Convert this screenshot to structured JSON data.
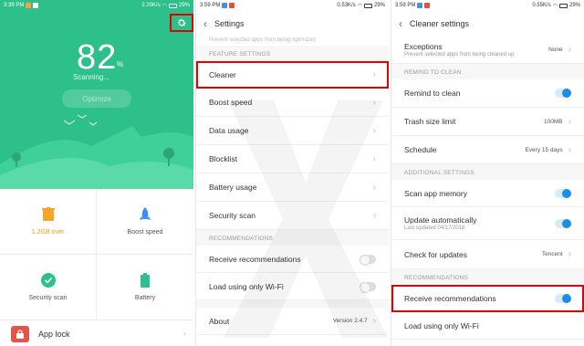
{
  "status": {
    "p1": {
      "time": "3:39 PM",
      "speed": "2.20K/s",
      "battery": "29%"
    },
    "p2": {
      "time": "3:59 PM",
      "speed": "0.53K/s",
      "battery": "29%"
    },
    "p3": {
      "time": "3:59 PM",
      "speed": "0.55K/s",
      "battery": "29%"
    }
  },
  "home": {
    "percent": "82",
    "percent_sign": "%",
    "scanning": "Scanning...",
    "optimize_label": "Optimize",
    "tiles": [
      {
        "label": "1.2GB over",
        "icon": "trash-icon"
      },
      {
        "label": "Boost speed",
        "icon": "rocket-icon"
      },
      {
        "label": "Security scan",
        "icon": "shield-check-icon"
      },
      {
        "label": "Battery",
        "icon": "battery-icon"
      }
    ],
    "app_lock": "App lock"
  },
  "settings": {
    "title": "Settings",
    "top_cut": "Prevent selected apps from being optimized",
    "feature_header": "FEATURE SETTINGS",
    "items": [
      "Cleaner",
      "Boost speed",
      "Data usage",
      "Blocklist",
      "Battery usage",
      "Security scan"
    ],
    "recommend_header": "RECOMMENDATIONS",
    "receive": "Receive recommendations",
    "wifi": "Load using only Wi-Fi",
    "about": "About",
    "version": "Version 2.4.7"
  },
  "cleaner": {
    "title": "Cleaner settings",
    "exceptions": "Exceptions",
    "exceptions_sub": "Prevent selected apps from being cleaned up",
    "exceptions_val": "None",
    "remind_header": "REMIND TO CLEAN",
    "remind": "Remind to clean",
    "trash": "Trash size limit",
    "trash_val": "100MB",
    "schedule": "Schedule",
    "schedule_val": "Every 15 days",
    "additional_header": "ADDITIONAL SETTINGS",
    "scan_memory": "Scan app memory",
    "update_auto": "Update automatically",
    "update_sub": "Last updated 04/17/2018",
    "check_updates": "Check for updates",
    "check_val": "Tencent",
    "recommend_header": "RECOMMENDATIONS",
    "receive": "Receive recommendations",
    "wifi": "Load using only Wi-Fi"
  },
  "colors": {
    "accent": "#2ec08a",
    "highlight": "#e60000",
    "toggle_on": "#1e8fe0"
  }
}
